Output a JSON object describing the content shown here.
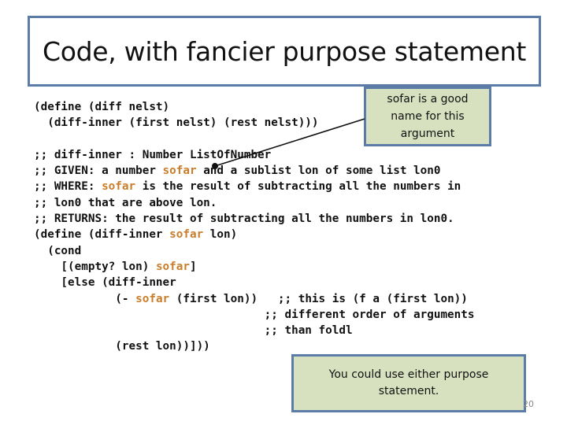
{
  "slide": {
    "title": "Code, with fancier purpose statement",
    "page_number": "20",
    "accent_color": "#5b7ca6",
    "callout_fill": "#d7e1bf",
    "highlight_color": "#c97d2a"
  },
  "code_lines": [
    [
      {
        "t": "(define (diff nelst)"
      }
    ],
    [
      {
        "t": "  (diff-inner (first nelst) (rest nelst)))"
      }
    ],
    [
      {
        "t": ""
      }
    ],
    [
      {
        "t": ";; diff-inner : Number ListOfNumber"
      }
    ],
    [
      {
        "t": ";; GIVEN: a number "
      },
      {
        "t": "sofar",
        "hl": true
      },
      {
        "t": " and a sublist lon of some list lon0"
      }
    ],
    [
      {
        "t": ";; WHERE: "
      },
      {
        "t": "sofar",
        "hl": true
      },
      {
        "t": " is the result of subtracting all the numbers in"
      }
    ],
    [
      {
        "t": ";; lon0 that are above lon."
      }
    ],
    [
      {
        "t": ";; RETURNS: the result of subtracting all the numbers in lon0."
      }
    ],
    [
      {
        "t": "(define (diff-inner "
      },
      {
        "t": "sofar",
        "hl": true
      },
      {
        "t": " lon)"
      }
    ],
    [
      {
        "t": "  (cond"
      }
    ],
    [
      {
        "t": "    [(empty? lon) "
      },
      {
        "t": "sofar",
        "hl": true
      },
      {
        "t": "]"
      }
    ],
    [
      {
        "t": "    [else (diff-inner"
      }
    ],
    [
      {
        "t": "            (- "
      },
      {
        "t": "sofar",
        "hl": true
      },
      {
        "t": " (first lon))   ;; this is (f a (first lon))"
      }
    ],
    [
      {
        "t": "                                  ;; different order of arguments"
      }
    ],
    [
      {
        "t": "                                  ;; than foldl"
      }
    ],
    [
      {
        "t": "            (rest lon))]))"
      }
    ]
  ],
  "callouts": {
    "top": "sofar is a good name for this argument",
    "bottom": "You could use either purpose statement."
  }
}
